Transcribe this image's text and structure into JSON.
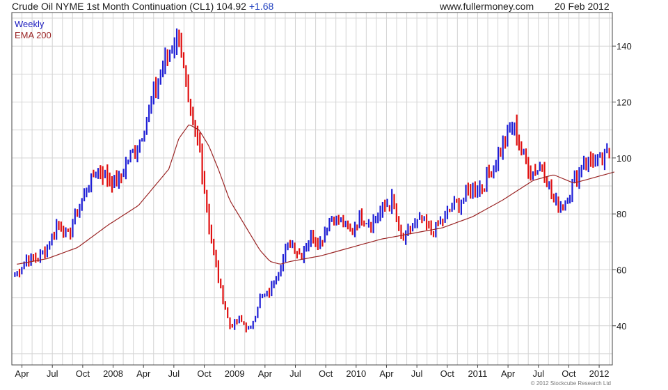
{
  "header": {
    "title": "Crude Oil NYME 1st Month Continuation (CL1) 104.92",
    "change": "+1.68",
    "site": "www.fullermoney.com",
    "date": "20 Feb 2012"
  },
  "legend": {
    "period": "Weekly",
    "ema": "EMA 200"
  },
  "copyright": "© 2012 Stockcube Research Ltd",
  "colors": {
    "up": "#1f1fd6",
    "down": "#e01010",
    "ema": "#9a2424",
    "grid": "#d4d4d4",
    "frame": "#444444"
  },
  "chart_data": {
    "type": "candlestick",
    "interval": "weekly",
    "ylim": [
      26,
      152
    ],
    "yticks": [
      40,
      60,
      80,
      100,
      120,
      140
    ],
    "y_axis_side": "right",
    "xlabels": [
      "Apr",
      "Jul",
      "Oct",
      "2008",
      "Apr",
      "Jul",
      "Oct",
      "2009",
      "Apr",
      "Jul",
      "Oct",
      "2010",
      "Apr",
      "Jul",
      "Oct",
      "2011",
      "Apr",
      "Jul",
      "Oct",
      "2012"
    ],
    "xrange": [
      "2007-03",
      "2012-02"
    ],
    "grid": true,
    "series": [
      {
        "name": "Weekly",
        "kind": "weekly close",
        "anchors": [
          [
            "2007-03",
            59
          ],
          [
            "2007-04",
            64
          ],
          [
            "2007-05",
            64
          ],
          [
            "2007-06",
            68
          ],
          [
            "2007-07",
            77
          ],
          [
            "2007-08",
            72
          ],
          [
            "2007-09",
            81
          ],
          [
            "2007-10",
            90
          ],
          [
            "2007-11",
            96
          ],
          [
            "2007-12",
            93
          ],
          [
            "2008-01",
            91
          ],
          [
            "2008-02",
            100
          ],
          [
            "2008-03",
            105
          ],
          [
            "2008-04",
            117
          ],
          [
            "2008-05",
            128
          ],
          [
            "2008-06",
            138
          ],
          [
            "2008-07",
            145
          ],
          [
            "2008-08",
            116
          ],
          [
            "2008-09",
            104
          ],
          [
            "2008-10",
            75
          ],
          [
            "2008-11",
            55
          ],
          [
            "2008-12",
            40
          ],
          [
            "2009-01",
            42
          ],
          [
            "2009-02",
            38
          ],
          [
            "2009-03",
            50
          ],
          [
            "2009-04",
            52
          ],
          [
            "2009-05",
            62
          ],
          [
            "2009-06",
            70
          ],
          [
            "2009-07",
            65
          ],
          [
            "2009-08",
            72
          ],
          [
            "2009-09",
            70
          ],
          [
            "2009-10",
            79
          ],
          [
            "2009-11",
            77
          ],
          [
            "2009-12",
            74
          ],
          [
            "2010-01",
            79
          ],
          [
            "2010-02",
            77
          ],
          [
            "2010-03",
            81
          ],
          [
            "2010-04",
            85
          ],
          [
            "2010-05",
            70
          ],
          [
            "2010-06",
            75
          ],
          [
            "2010-07",
            78
          ],
          [
            "2010-08",
            73
          ],
          [
            "2010-09",
            78
          ],
          [
            "2010-10",
            82
          ],
          [
            "2010-11",
            85
          ],
          [
            "2010-12",
            90
          ],
          [
            "2011-01",
            90
          ],
          [
            "2011-02",
            97
          ],
          [
            "2011-03",
            104
          ],
          [
            "2011-04",
            112
          ],
          [
            "2011-05",
            100
          ],
          [
            "2011-06",
            95
          ],
          [
            "2011-07",
            97
          ],
          [
            "2011-08",
            84
          ],
          [
            "2011-09",
            83
          ],
          [
            "2011-10",
            92
          ],
          [
            "2011-11",
            99
          ],
          [
            "2011-12",
            99
          ],
          [
            "2012-01",
            99
          ],
          [
            "2012-02",
            105
          ]
        ]
      },
      {
        "name": "EMA 200",
        "kind": "line",
        "anchors": [
          [
            "2007-03",
            62
          ],
          [
            "2007-06",
            64
          ],
          [
            "2007-09",
            68
          ],
          [
            "2007-12",
            76
          ],
          [
            "2008-03",
            83
          ],
          [
            "2008-06",
            96
          ],
          [
            "2008-07",
            107
          ],
          [
            "2008-08",
            112
          ],
          [
            "2008-09",
            110
          ],
          [
            "2008-10",
            104
          ],
          [
            "2008-11",
            95
          ],
          [
            "2008-12",
            85
          ],
          [
            "2009-01",
            79
          ],
          [
            "2009-02",
            73
          ],
          [
            "2009-03",
            67
          ],
          [
            "2009-04",
            63
          ],
          [
            "2009-05",
            62
          ],
          [
            "2009-06",
            63
          ],
          [
            "2009-09",
            65
          ],
          [
            "2009-12",
            68
          ],
          [
            "2010-03",
            71
          ],
          [
            "2010-06",
            73
          ],
          [
            "2010-09",
            75
          ],
          [
            "2010-12",
            79
          ],
          [
            "2011-03",
            85
          ],
          [
            "2011-06",
            92
          ],
          [
            "2011-08",
            94
          ],
          [
            "2011-10",
            91
          ],
          [
            "2011-12",
            93
          ],
          [
            "2012-02",
            95
          ]
        ]
      }
    ]
  }
}
